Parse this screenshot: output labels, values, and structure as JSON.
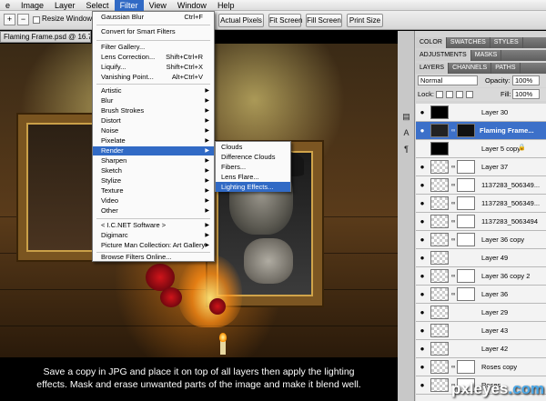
{
  "menubar": {
    "items": [
      "e",
      "Image",
      "Layer",
      "Select",
      "Filter",
      "View",
      "Window",
      "Help"
    ],
    "active": "Filter"
  },
  "options_bar": {
    "resize_label": "Resize Windows To",
    "buttons": [
      "Actual Pixels",
      "Fit Screen",
      "Fill Screen",
      "Print Size"
    ]
  },
  "document_tab": {
    "title": "Flaming Frame.psd @ 16.7%"
  },
  "filter_menu": {
    "top": [
      {
        "label": "Gaussian Blur",
        "shortcut": "Ctrl+F"
      },
      {
        "label": "Convert for Smart Filters",
        "shortcut": ""
      },
      {
        "label": "Filter Gallery...",
        "shortcut": ""
      },
      {
        "label": "Lens Correction...",
        "shortcut": "Shift+Ctrl+R"
      },
      {
        "label": "Liquify...",
        "shortcut": "Shift+Ctrl+X"
      },
      {
        "label": "Vanishing Point...",
        "shortcut": "Alt+Ctrl+V"
      }
    ],
    "categories": [
      "Artistic",
      "Blur",
      "Brush Strokes",
      "Distort",
      "Noise",
      "Pixelate",
      "Render",
      "Sharpen",
      "Sketch",
      "Stylize",
      "Texture",
      "Video",
      "Other"
    ],
    "highlighted": "Render",
    "plugins": [
      "< I.C.NET Software >",
      "Digimarc",
      "Picture Man Collection: Art Gallery"
    ],
    "browse": "Browse Filters Online..."
  },
  "render_submenu": {
    "items": [
      "Clouds",
      "Difference Clouds",
      "Fibers...",
      "Lens Flare...",
      "Lighting Effects..."
    ],
    "highlighted": "Lighting Effects..."
  },
  "caption": {
    "line1": "Save a copy in JPG and place it on top of all layers then apply the lighting",
    "line2": "effects. Mask and erase unwanted parts of the image and make it blend well."
  },
  "panels": {
    "tabs_row1": [
      "COLOR",
      "SWATCHES",
      "STYLES"
    ],
    "tabs_row2": [
      "ADJUSTMENTS",
      "MASKS"
    ],
    "tabs_row3": [
      "LAYERS",
      "CHANNELS",
      "PATHS"
    ],
    "blend_mode": "Normal",
    "opacity_label": "Opacity:",
    "opacity_value": "100%",
    "lock_label": "Lock:",
    "fill_label": "Fill:",
    "fill_value": "100%",
    "layers": [
      {
        "name": "Layer 30",
        "selected": false,
        "eye": true,
        "mask": false
      },
      {
        "name": "Flaming Frame...",
        "selected": true,
        "eye": true,
        "mask": true
      },
      {
        "name": "Layer 5 copy",
        "selected": false,
        "eye": false,
        "mask": false,
        "locked": true
      },
      {
        "name": "Layer 37",
        "selected": false,
        "eye": true,
        "mask": true
      },
      {
        "name": "1137283_506349...",
        "selected": false,
        "eye": true,
        "mask": true
      },
      {
        "name": "1137283_506349...",
        "selected": false,
        "eye": true,
        "mask": true
      },
      {
        "name": "1137283_5063494",
        "selected": false,
        "eye": true,
        "mask": true
      },
      {
        "name": "Layer 36 copy",
        "selected": false,
        "eye": true,
        "mask": true
      },
      {
        "name": "Layer 49",
        "selected": false,
        "eye": true,
        "mask": false
      },
      {
        "name": "Layer 36 copy 2",
        "selected": false,
        "eye": true,
        "mask": true
      },
      {
        "name": "Layer 36",
        "selected": false,
        "eye": true,
        "mask": true
      },
      {
        "name": "Layer 29",
        "selected": false,
        "eye": true,
        "mask": false
      },
      {
        "name": "Layer 43",
        "selected": false,
        "eye": true,
        "mask": false
      },
      {
        "name": "Layer 42",
        "selected": false,
        "eye": true,
        "mask": false
      },
      {
        "name": "Roses copy",
        "selected": false,
        "eye": true,
        "mask": true
      },
      {
        "name": "Roses",
        "selected": false,
        "eye": true,
        "mask": true
      }
    ]
  },
  "watermark": {
    "main": "pxleyes",
    "accent": ".com"
  },
  "colors": {
    "highlight": "#316ac5",
    "layer_selected": "#3c70c9"
  }
}
